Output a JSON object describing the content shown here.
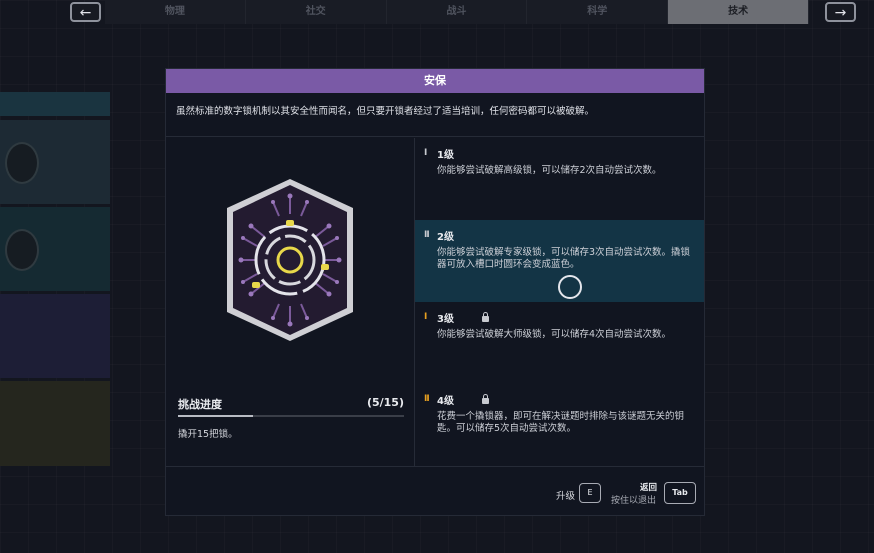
{
  "nav": {
    "prev_label": "←",
    "next_label": "→",
    "tabs": [
      {
        "label": "物理",
        "active": false
      },
      {
        "label": "社交",
        "active": false
      },
      {
        "label": "战斗",
        "active": false
      },
      {
        "label": "科学",
        "active": false
      },
      {
        "label": "技术",
        "active": true
      }
    ]
  },
  "modal": {
    "title": "安保",
    "description": "虽然标准的数字锁机制以其安全性而闻名，但只要开锁者经过了适当培训，任何密码都可以被破解。",
    "challenge": {
      "title": "挑战进度",
      "count": "(5/15)",
      "progress_fraction": 0.333,
      "description": "撬开15把锁。"
    },
    "levels": [
      {
        "title": "1级",
        "mark": "I",
        "description": "你能够尝试破解高级锁，可以储存2次自动尝试次数。",
        "locked": false,
        "selected": false
      },
      {
        "title": "2级",
        "mark": "II",
        "description": "你能够尝试破解专家级锁，可以储存3次自动尝试次数。撬锁器可放入槽口时圆环会变成蓝色。",
        "locked": false,
        "selected": true
      },
      {
        "title": "3级",
        "mark": "I",
        "description": "你能够尝试破解大师级锁，可以储存4次自动尝试次数。",
        "locked": true,
        "selected": false
      },
      {
        "title": "4级",
        "mark": "II",
        "description": "花费一个撬锁器，即可在解决谜题时排除与该谜题无关的钥匙。可以储存5次自动尝试次数。",
        "locked": true,
        "selected": false
      }
    ],
    "footer": {
      "upgrade_label": "升级",
      "upgrade_key": "E",
      "back_label": "返回",
      "hold_label": "按住以退出",
      "back_key": "Tab"
    }
  },
  "colors": {
    "header": "#7a5aa6",
    "selected_row": "#133445",
    "badge_accent": "#e8d84a",
    "level_mark_unlocked": "#c8cad0",
    "level_mark_locked": "#e8a020"
  },
  "icons": {
    "badge": "circuit-lock-badge-icon",
    "lock": "lock-icon"
  }
}
